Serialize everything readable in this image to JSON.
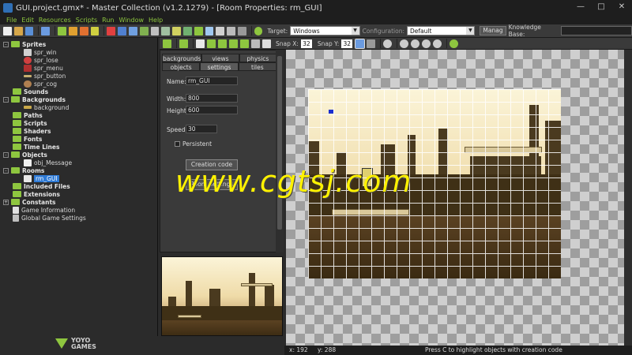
{
  "window": {
    "title": "GUI.project.gmx*  -  Master Collection (v1.2.1279) - [Room Properties: rm_GUI]"
  },
  "menu": [
    "File",
    "Edit",
    "Resources",
    "Scripts",
    "Run",
    "Window",
    "Help"
  ],
  "toolbar": {
    "target_label": "Target:",
    "target_value": "Windows",
    "config_label": "Configuration:",
    "config_value": "Default",
    "manage_label": "Manag",
    "knowledge_label": "Knowledge Base:"
  },
  "tree": {
    "sprites": {
      "label": "Sprites",
      "items": [
        "spr_win",
        "spr_lose",
        "spr_menu",
        "spr_button",
        "spr_cog"
      ]
    },
    "sounds": "Sounds",
    "backgrounds": {
      "label": "Backgrounds",
      "items": [
        "background"
      ]
    },
    "paths": "Paths",
    "scripts": "Scripts",
    "shaders": "Shaders",
    "fonts": "Fonts",
    "timelines": "Time Lines",
    "objects": {
      "label": "Objects",
      "items": [
        "obj_Message"
      ]
    },
    "rooms": {
      "label": "Rooms",
      "items": [
        "rm_GUI"
      ]
    },
    "included_files": "Included Files",
    "extensions": "Extensions",
    "constants": "Constants",
    "game_information": "Game Information",
    "global_settings": "Global Game Settings"
  },
  "room_toolbar": {
    "snap_x_label": "Snap X:",
    "snap_x": "32",
    "snap_y_label": "Snap Y:",
    "snap_y": "32"
  },
  "props": {
    "tabs_row1": [
      "backgrounds",
      "views",
      "physics"
    ],
    "tabs_row2": [
      "objects",
      "settings",
      "tiles"
    ],
    "name_label": "Name:",
    "name_value": "rm_GUI",
    "width_label": "Width:",
    "width_value": "800",
    "height_label": "Height:",
    "height_value": "600",
    "speed_label": "Speed:",
    "speed_value": "30",
    "persistent_label": "Persistent",
    "creation_code_label": "Creation code",
    "room_settings_label": "Room Settings"
  },
  "status": {
    "x": "x: 192",
    "y": "y: 288",
    "hint": "Press C to highlight objects with creation code"
  },
  "logo": {
    "line1": "YOYO",
    "line2": "GAMES"
  },
  "watermark": "www.cgtsj.com",
  "colors": {
    "accent_green": "#8ec63f",
    "selection_blue": "#2f7bd6",
    "watermark_yellow": "#fff200"
  }
}
